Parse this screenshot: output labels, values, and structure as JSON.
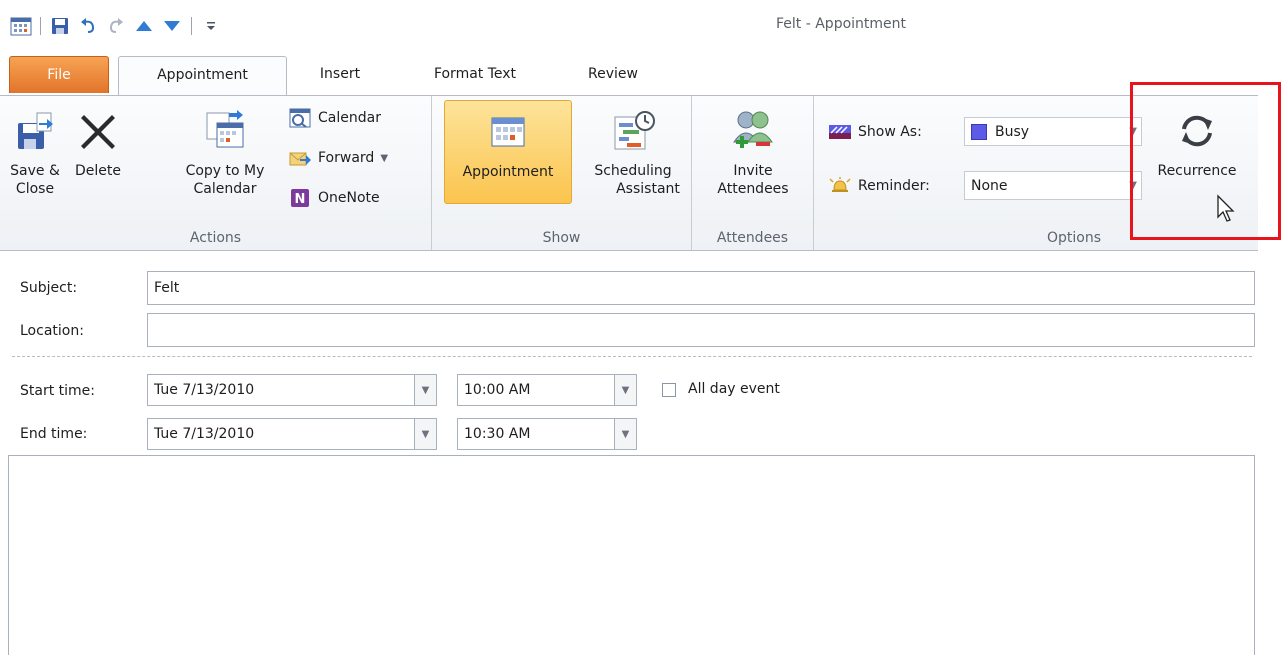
{
  "window": {
    "title": "Felt - Appointment"
  },
  "tabs": [
    {
      "label": "File"
    },
    {
      "label": "Appointment"
    },
    {
      "label": "Insert"
    },
    {
      "label": "Format Text"
    },
    {
      "label": "Review"
    }
  ],
  "ribbon": {
    "actions": {
      "label": "Actions",
      "save_close": [
        "Save &",
        "Close"
      ],
      "delete": "Delete",
      "copy_to_calendar": [
        "Copy to My",
        "Calendar"
      ],
      "calendar": "Calendar",
      "forward": "Forward",
      "onenote": "OneNote"
    },
    "show": {
      "label": "Show",
      "appointment": "Appointment",
      "scheduling_assistant": [
        "Scheduling",
        "Assistant"
      ]
    },
    "attendees": {
      "label": "Attendees",
      "invite_attendees": [
        "Invite",
        "Attendees"
      ]
    },
    "options": {
      "label": "Options",
      "show_as_label": "Show As:",
      "show_as_value": "Busy",
      "reminder_label": "Reminder:",
      "reminder_value": "None",
      "recurrence": "Recurrence"
    }
  },
  "form": {
    "subject_label": "Subject:",
    "subject_value": "Felt",
    "location_label": "Location:",
    "location_value": "",
    "start_label": "Start time:",
    "start_date": "Tue 7/13/2010",
    "start_time": "10:00 AM",
    "all_day_label": "All day event",
    "end_label": "End time:",
    "end_date": "Tue 7/13/2010",
    "end_time": "10:30 AM"
  },
  "colors": {
    "file_tab": "#e2742a",
    "selected_button": "#fbc44e",
    "highlight_box": "#e8141b",
    "busy_swatch": "#5b5be8"
  }
}
